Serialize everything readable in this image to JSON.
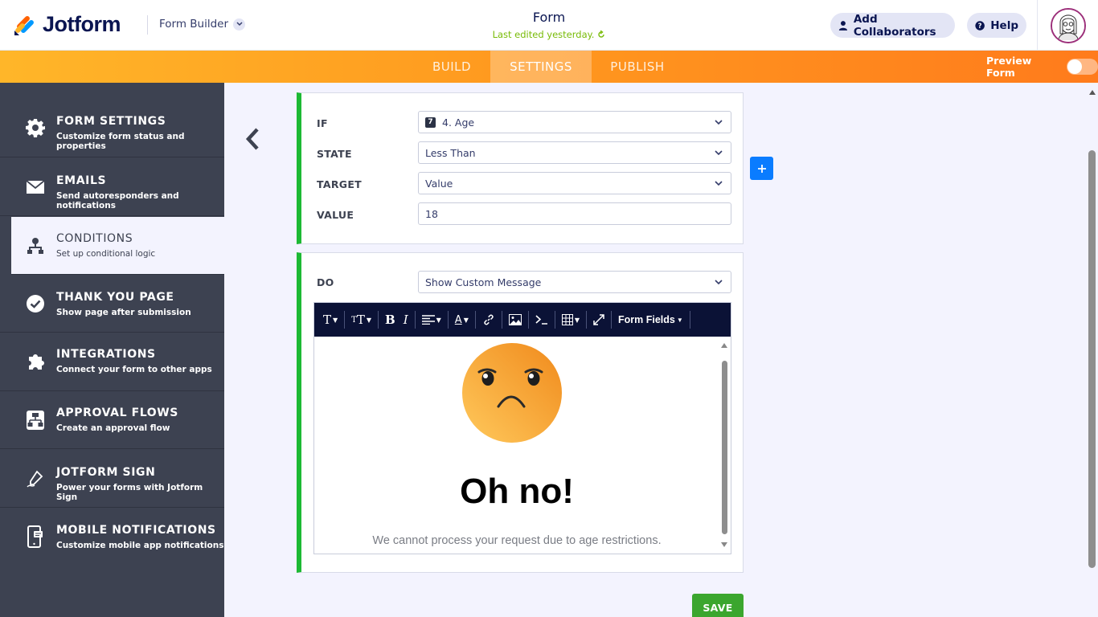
{
  "header": {
    "brand": "Jotform",
    "builder_switch": "Form Builder",
    "form_title": "Form",
    "last_edited": "Last edited yesterday.",
    "collaborators_label": "Add Collaborators",
    "help_label": "Help"
  },
  "nav": {
    "tabs": [
      {
        "label": "BUILD"
      },
      {
        "label": "SETTINGS"
      },
      {
        "label": "PUBLISH"
      }
    ],
    "preview_label": "Preview Form",
    "preview_enabled": false
  },
  "sidebar": {
    "items": [
      {
        "title": "FORM SETTINGS",
        "subtitle": "Customize form status and properties",
        "icon": "gear-icon"
      },
      {
        "title": "EMAILS",
        "subtitle": "Send autoresponders and notifications",
        "icon": "envelope-icon"
      },
      {
        "title": "CONDITIONS",
        "subtitle": "Set up conditional logic",
        "icon": "hierarchy-icon",
        "active": true
      },
      {
        "title": "THANK YOU PAGE",
        "subtitle": "Show page after submission",
        "icon": "check-circle-icon"
      },
      {
        "title": "INTEGRATIONS",
        "subtitle": "Connect your form to other apps",
        "icon": "puzzle-icon"
      },
      {
        "title": "APPROVAL FLOWS",
        "subtitle": "Create an approval flow",
        "icon": "flow-icon"
      },
      {
        "title": "JOTFORM SIGN",
        "subtitle": "Power your forms with Jotform Sign",
        "icon": "pen-sign-icon"
      },
      {
        "title": "MOBILE NOTIFICATIONS",
        "subtitle": "Customize mobile app notifications",
        "icon": "mobile-icon"
      }
    ]
  },
  "condition": {
    "if_label": "IF",
    "if_field_number": "7",
    "if_value": "4. Age",
    "state_label": "STATE",
    "state_value": "Less Than",
    "target_label": "TARGET",
    "target_value": "Value",
    "value_label": "VALUE",
    "value_value": "18"
  },
  "action": {
    "do_label": "DO",
    "do_value": "Show Custom Message",
    "toolbar": {
      "form_fields_label": "Form Fields"
    },
    "message_heading": "Oh no!",
    "message_text": "We cannot process your request due to age restrictions."
  },
  "save_label": "SAVE",
  "colors": {
    "accent_orange": "#ff7b1c",
    "sidebar_bg": "#3d4251",
    "condition_border": "#1db934",
    "save_green": "#3ba62e",
    "plus_blue": "#0a7cff"
  }
}
